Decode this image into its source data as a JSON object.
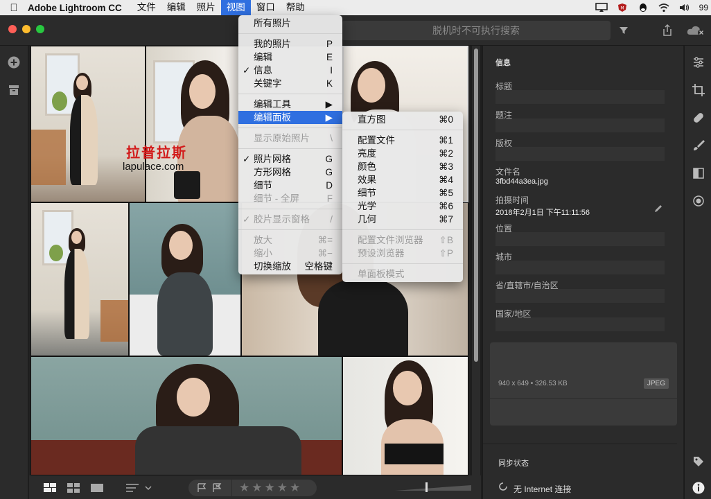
{
  "menubar": {
    "app_name": "Adobe Lightroom CC",
    "items": [
      "文件",
      "编辑",
      "照片",
      "视图",
      "窗口",
      "帮助"
    ],
    "active_index": 3,
    "battery": "99"
  },
  "toolbar": {
    "search_placeholder": "脱机时不可执行搜索"
  },
  "grid": {
    "watermark_cn": "拉普拉斯",
    "watermark_url": "lapulace.com"
  },
  "view_menu": {
    "items": [
      {
        "label": "所有照片",
        "shortcut": "",
        "checked": false,
        "disabled": false,
        "highlighted": false
      },
      {
        "sep": true
      },
      {
        "label": "我的照片",
        "shortcut": "P",
        "checked": false,
        "disabled": false,
        "highlighted": false
      },
      {
        "label": "编辑",
        "shortcut": "E",
        "checked": false,
        "disabled": false,
        "highlighted": false
      },
      {
        "label": "信息",
        "shortcut": "I",
        "checked": true,
        "disabled": false,
        "highlighted": false
      },
      {
        "label": "关键字",
        "shortcut": "K",
        "checked": false,
        "disabled": false,
        "highlighted": false
      },
      {
        "sep": true
      },
      {
        "label": "编辑工具",
        "shortcut": "▶",
        "checked": false,
        "disabled": false,
        "highlighted": false
      },
      {
        "label": "编辑面板",
        "shortcut": "▶",
        "checked": false,
        "disabled": false,
        "highlighted": true
      },
      {
        "sep": true
      },
      {
        "label": "显示原始照片",
        "shortcut": "\\",
        "checked": false,
        "disabled": true,
        "highlighted": false
      },
      {
        "sep": true
      },
      {
        "label": "照片网格",
        "shortcut": "G",
        "checked": true,
        "disabled": false,
        "highlighted": false
      },
      {
        "label": "方形网格",
        "shortcut": "G",
        "checked": false,
        "disabled": false,
        "highlighted": false
      },
      {
        "label": "细节",
        "shortcut": "D",
        "checked": false,
        "disabled": false,
        "highlighted": false
      },
      {
        "label": "细节 - 全屏",
        "shortcut": "F",
        "checked": false,
        "disabled": true,
        "highlighted": false
      },
      {
        "sep": true
      },
      {
        "label": "胶片显示窗格",
        "shortcut": "/",
        "checked": true,
        "disabled": true,
        "highlighted": false
      },
      {
        "sep": true
      },
      {
        "label": "放大",
        "shortcut": "⌘=",
        "checked": false,
        "disabled": true,
        "highlighted": false
      },
      {
        "label": "缩小",
        "shortcut": "⌘−",
        "checked": false,
        "disabled": true,
        "highlighted": false
      },
      {
        "label": "切换缩放",
        "shortcut": "空格键",
        "checked": false,
        "disabled": false,
        "highlighted": false
      }
    ]
  },
  "panel_submenu": {
    "items": [
      {
        "label": "直方图",
        "shortcut": "⌘0",
        "disabled": false
      },
      {
        "sep": true
      },
      {
        "label": "配置文件",
        "shortcut": "⌘1",
        "disabled": false
      },
      {
        "label": "亮度",
        "shortcut": "⌘2",
        "disabled": false
      },
      {
        "label": "颜色",
        "shortcut": "⌘3",
        "disabled": false
      },
      {
        "label": "效果",
        "shortcut": "⌘4",
        "disabled": false
      },
      {
        "label": "细节",
        "shortcut": "⌘5",
        "disabled": false
      },
      {
        "label": "光学",
        "shortcut": "⌘6",
        "disabled": false
      },
      {
        "label": "几何",
        "shortcut": "⌘7",
        "disabled": false
      },
      {
        "sep": true
      },
      {
        "label": "配置文件浏览器",
        "shortcut": "⇧B",
        "disabled": true
      },
      {
        "label": "预设浏览器",
        "shortcut": "⇧P",
        "disabled": true
      },
      {
        "sep": true
      },
      {
        "label": "单面板模式",
        "shortcut": "",
        "disabled": true
      }
    ]
  },
  "info_panel": {
    "title": "信息",
    "title_label": "标题",
    "caption_label": "题注",
    "copyright_label": "版权",
    "filename_label": "文件名",
    "filename": "3fbd44a3ea.jpg",
    "capture_label": "拍摄时间",
    "capture_time": "2018年2月1日 下午11:11:56",
    "location_label": "位置",
    "city_label": "城市",
    "state_label": "省/直辖市/自治区",
    "country_label": "国家/地区",
    "dimensions": "940 x 649 • 326.53 KB",
    "format_badge": "JPEG",
    "sync_title": "同步状态",
    "sync_status": "无 Internet 连接"
  },
  "rating": {
    "stars": "★★★★★"
  },
  "colors": {
    "menu_highlight": "#2f6fe0",
    "panel_bg": "#2b2b2b",
    "traffic_red": "#fe5f57",
    "traffic_yellow": "#febc2e",
    "traffic_green": "#28c840"
  }
}
